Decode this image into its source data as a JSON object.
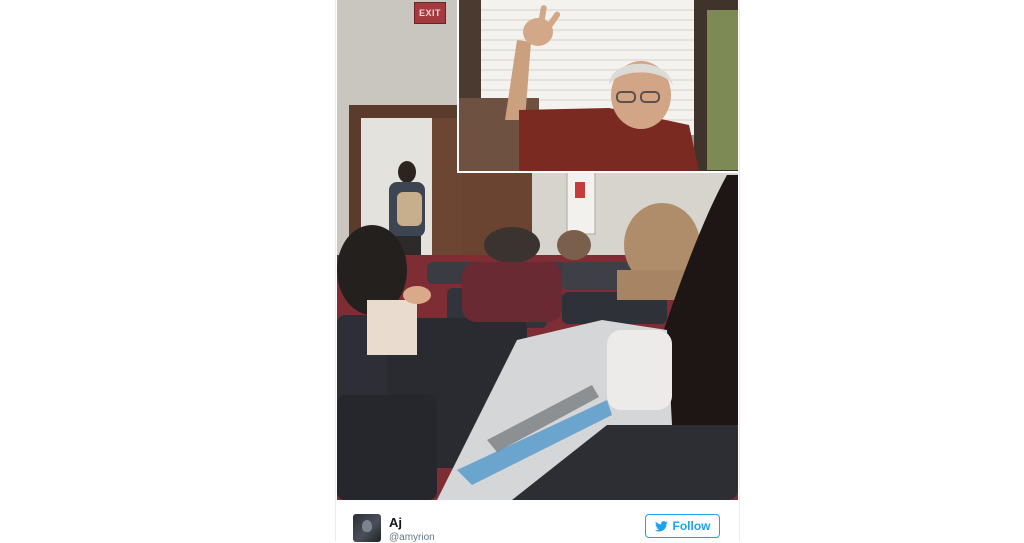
{
  "photo": {
    "exit_sign": "EXIT"
  },
  "tweet": {
    "author_name": "Aj",
    "author_handle": "@amyrion",
    "follow_label": "Follow"
  },
  "colors": {
    "twitter_blue": "#1da1f2",
    "name_text": "#14171a",
    "handle_text": "#657786"
  },
  "icons": [
    "twitter-bird-icon",
    "avatar"
  ]
}
